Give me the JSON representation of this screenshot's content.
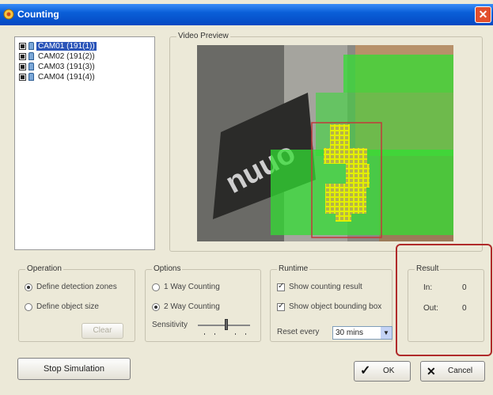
{
  "window": {
    "title": "Counting"
  },
  "camera_tree": {
    "items": [
      {
        "label": "CAM01 (191(1))",
        "selected": true
      },
      {
        "label": "CAM02 (191(2))",
        "selected": false
      },
      {
        "label": "CAM03 (191(3))",
        "selected": false
      },
      {
        "label": "CAM04 (191(4))",
        "selected": false
      }
    ]
  },
  "video_preview": {
    "label": "Video Preview",
    "overlay_text": "nuuo"
  },
  "operation": {
    "label": "Operation",
    "options": [
      "Define detection zones",
      "Define object size"
    ],
    "selected": 0,
    "clear_label": "Clear"
  },
  "options": {
    "label": "Options",
    "radio": [
      "1 Way Counting",
      "2 Way Counting"
    ],
    "selected": 1,
    "sensitivity_label": "Sensitivity"
  },
  "runtime": {
    "label": "Runtime",
    "show_counting_result": "Show counting result",
    "show_bounding_box": "Show object bounding box",
    "reset_label": "Reset every",
    "reset_value": "30 mins"
  },
  "result": {
    "label": "Result",
    "in_label": "In:",
    "in_value": "0",
    "out_label": "Out:",
    "out_value": "0"
  },
  "buttons": {
    "stop_simulation": "Stop Simulation",
    "ok": "OK",
    "cancel": "Cancel"
  },
  "colors": {
    "zone_green": "#33dd33",
    "highlight_red": "#b02a2a",
    "title_blue": "#0a5fd8"
  }
}
